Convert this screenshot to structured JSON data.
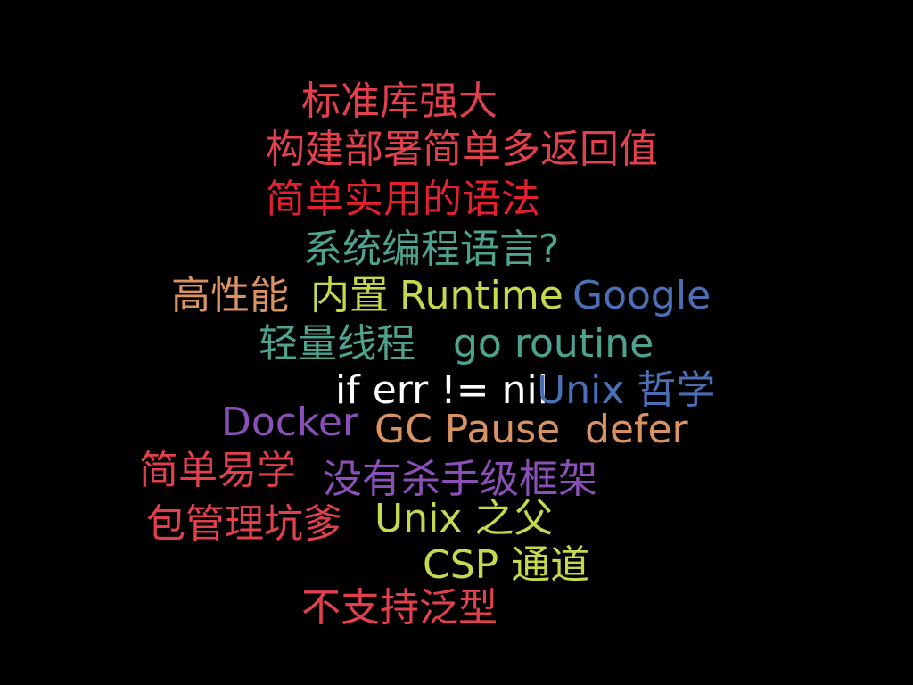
{
  "colors": {
    "background": "#000000",
    "red": "#e2404d",
    "teal": "#4ea38f",
    "orange": "#d99262",
    "yellow": "#c6d84e",
    "blue": "#4b6fb5",
    "purple": "#8a50b8",
    "white": "#ffffff"
  },
  "words": [
    {
      "text": "标准库强大",
      "color": "#e2404d"
    },
    {
      "text": "构建部署简单多返回值",
      "color": "#e2404d"
    },
    {
      "text": "简单实用的语法",
      "color": "#e2202e"
    },
    {
      "text": "系统编程语言?",
      "color": "#4ea38f"
    },
    {
      "text": "高性能",
      "color": "#d99262"
    },
    {
      "text": "内置",
      "color": "#c6d84e"
    },
    {
      "text": "Runtime",
      "color": "#c6d84e"
    },
    {
      "text": "Google",
      "color": "#4b6fb5"
    },
    {
      "text": "轻量线程",
      "color": "#4ea38f"
    },
    {
      "text": "go routine",
      "color": "#4ea38f"
    },
    {
      "text": "if err != nil",
      "color": "#ffffff"
    },
    {
      "text": "Unix 哲学",
      "color": "#4b6fb5"
    },
    {
      "text": "Docker",
      "color": "#8a50b8"
    },
    {
      "text": "GC Pause",
      "color": "#d99262"
    },
    {
      "text": "defer",
      "color": "#d99262"
    },
    {
      "text": "简单易学",
      "color": "#e2404d"
    },
    {
      "text": "没有杀手级框架",
      "color": "#8a50b8"
    },
    {
      "text": "包管理坑爹",
      "color": "#e2404d"
    },
    {
      "text": "Unix 之父",
      "color": "#c6d84e"
    },
    {
      "text": "CSP 通道",
      "color": "#c6d84e"
    },
    {
      "text": "不支持泛型",
      "color": "#e2404d"
    }
  ]
}
